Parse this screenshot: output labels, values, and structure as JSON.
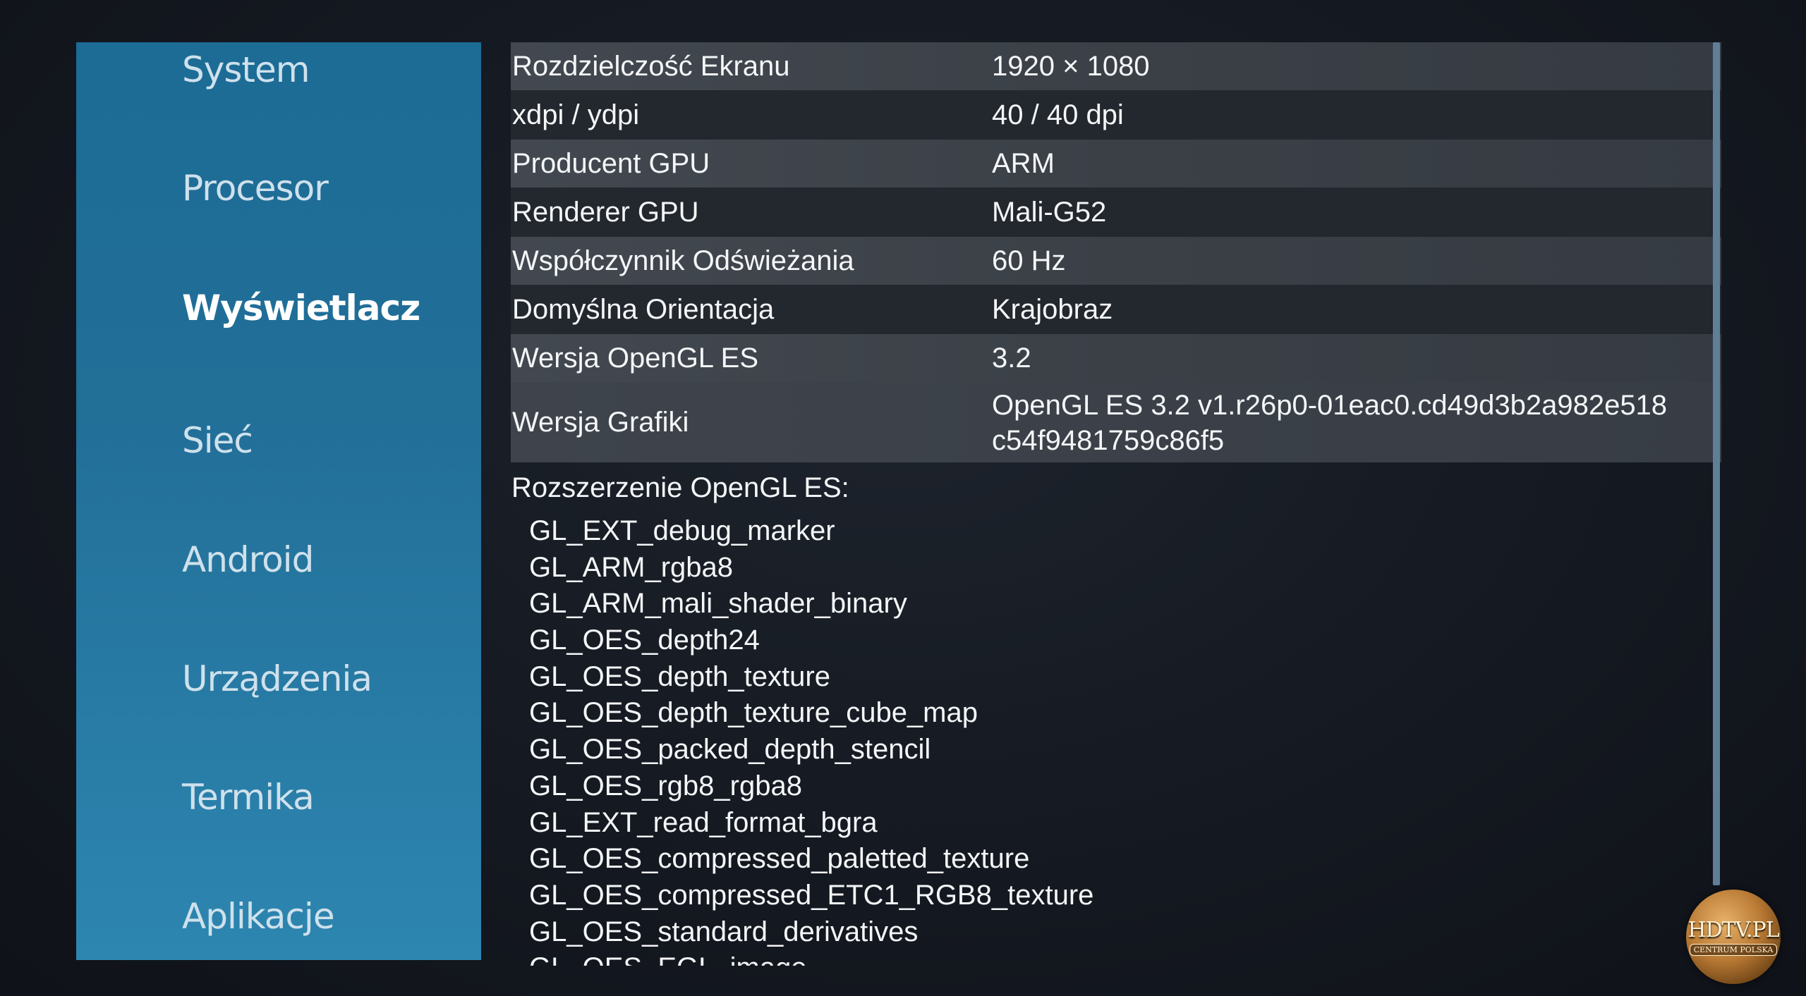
{
  "sidebar": {
    "items": [
      {
        "label": "System",
        "active": false
      },
      {
        "label": "Procesor",
        "active": false
      },
      {
        "label": "Wyświetlacz",
        "active": true
      },
      {
        "label": "Sieć",
        "active": false
      },
      {
        "label": "Android",
        "active": false
      },
      {
        "label": "Urządzenia",
        "active": false
      },
      {
        "label": "Termika",
        "active": false
      },
      {
        "label": "Aplikacje",
        "active": false
      }
    ]
  },
  "display_info": {
    "rows": [
      {
        "label": "Rozdzielczość Ekranu",
        "value": "1920 × 1080"
      },
      {
        "label": "xdpi / ydpi",
        "value": "40 / 40 dpi"
      },
      {
        "label": "Producent GPU",
        "value": "ARM"
      },
      {
        "label": "Renderer GPU",
        "value": "Mali-G52"
      },
      {
        "label": "Współczynnik Odświeżania",
        "value": "60 Hz"
      },
      {
        "label": "Domyślna Orientacja",
        "value": "Krajobraz"
      },
      {
        "label": "Wersja OpenGL ES",
        "value": "3.2"
      },
      {
        "label": "Wersja Grafiki",
        "value_line1": "OpenGL ES 3.2 v1.r26p0-01eac0.cd49d3b2a982e518",
        "value_line2": "c54f9481759c86f5"
      }
    ]
  },
  "extensions": {
    "title": "Rozszerzenie OpenGL ES:",
    "items": [
      "GL_EXT_debug_marker",
      "GL_ARM_rgba8",
      "GL_ARM_mali_shader_binary",
      "GL_OES_depth24",
      "GL_OES_depth_texture",
      "GL_OES_depth_texture_cube_map",
      "GL_OES_packed_depth_stencil",
      "GL_OES_rgb8_rgba8",
      "GL_EXT_read_format_bgra",
      "GL_OES_compressed_paletted_texture",
      "GL_OES_compressed_ETC1_RGB8_texture",
      "GL_OES_standard_derivatives",
      "GL_OES_EGL_image"
    ]
  },
  "watermark": {
    "main": "HDTV.PL",
    "sub": "CENTRUM POLSKA"
  }
}
